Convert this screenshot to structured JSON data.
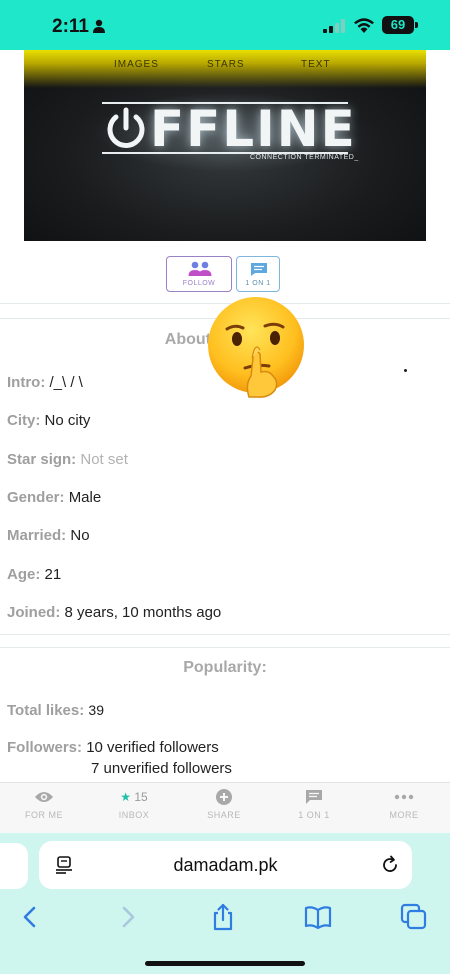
{
  "status_bar": {
    "time": "2:11",
    "battery": "69"
  },
  "banner": {
    "tabs": [
      "IMAGES",
      "STARS",
      "TEXT"
    ],
    "logo_text": "FFLINE",
    "subtitle": "CONNECTION TERMINATED_"
  },
  "actions": {
    "follow_label": "FOLLOW",
    "one_on_one_label": "1 ON 1"
  },
  "about": {
    "title": "About T",
    "fields": [
      {
        "key": "Intro:",
        "value": "/_\\ / \\"
      },
      {
        "key": "City:",
        "value": "No city"
      },
      {
        "key": "Star sign:",
        "value": "Not set"
      },
      {
        "key": "Gender:",
        "value": "Male"
      },
      {
        "key": "Married:",
        "value": "No"
      },
      {
        "key": "Age:",
        "value": "21"
      },
      {
        "key": "Joined:",
        "value": "8 years, 10 months ago"
      }
    ]
  },
  "popularity": {
    "title": "Popularity:",
    "total_likes_key": "Total likes:",
    "total_likes": "39",
    "followers_key": "Followers:",
    "verified": "10 verified followers",
    "unverified": "7 unverified followers"
  },
  "bottom_nav": {
    "for_me": "FOR ME",
    "inbox_star": "★",
    "inbox_count": "15",
    "inbox": "INBOX",
    "share": "SHARE",
    "one_on_one": "1 ON 1",
    "more": "MORE"
  },
  "browser": {
    "url": "damadam.pk"
  },
  "colors": {
    "status_bar": "#1fe7c9",
    "safari_bg": "#cff5ef",
    "follow_accent": "#9a82c8",
    "chat_accent": "#5ea8e0"
  }
}
